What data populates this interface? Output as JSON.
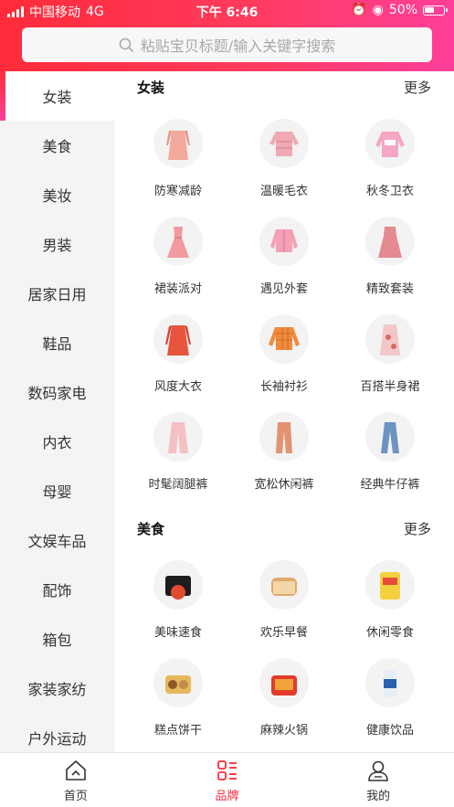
{
  "status_bar": {
    "carrier": "中国移动",
    "network": "4G",
    "time": "下午 6:46",
    "battery": "50%"
  },
  "search": {
    "placeholder": "粘贴宝贝标题/输入关键字搜索"
  },
  "colors": {
    "accent": "#ff2b3a",
    "accent_end": "#ff3f9a"
  },
  "sidebar": {
    "items": [
      {
        "label": "女装",
        "active": true
      },
      {
        "label": "美食"
      },
      {
        "label": "美妆"
      },
      {
        "label": "男装"
      },
      {
        "label": "居家日用"
      },
      {
        "label": "鞋品"
      },
      {
        "label": "数码家电"
      },
      {
        "label": "内衣"
      },
      {
        "label": "母婴"
      },
      {
        "label": "文娱车品"
      },
      {
        "label": "配饰"
      },
      {
        "label": "箱包"
      },
      {
        "label": "家装家纺"
      },
      {
        "label": "户外运动"
      }
    ]
  },
  "sections": [
    {
      "title": "女装",
      "more": "更多",
      "items": [
        {
          "label": "防寒减龄",
          "icon": "coat-icon"
        },
        {
          "label": "温暖毛衣",
          "icon": "sweater-icon"
        },
        {
          "label": "秋冬卫衣",
          "icon": "hoodie-icon"
        },
        {
          "label": "裙装派对",
          "icon": "dress-icon"
        },
        {
          "label": "遇见外套",
          "icon": "jacket-icon"
        },
        {
          "label": "精致套装",
          "icon": "long-dress-icon"
        },
        {
          "label": "风度大衣",
          "icon": "overcoat-icon"
        },
        {
          "label": "长袖衬衫",
          "icon": "shirt-icon"
        },
        {
          "label": "百搭半身裙",
          "icon": "skirt-icon"
        },
        {
          "label": "时髦阔腿裤",
          "icon": "wide-pants-icon"
        },
        {
          "label": "宽松休闲裤",
          "icon": "casual-pants-icon"
        },
        {
          "label": "经典牛仔裤",
          "icon": "jeans-icon"
        }
      ]
    },
    {
      "title": "美食",
      "more": "更多",
      "items": [
        {
          "label": "美味速食",
          "icon": "instant-food-icon"
        },
        {
          "label": "欢乐早餐",
          "icon": "bread-icon"
        },
        {
          "label": "休闲零食",
          "icon": "chips-icon"
        },
        {
          "label": "糕点饼干",
          "icon": "cookies-icon"
        },
        {
          "label": "麻辣火锅",
          "icon": "hotpot-icon"
        },
        {
          "label": "健康饮品",
          "icon": "drink-icon"
        }
      ]
    }
  ],
  "tabbar": {
    "tabs": [
      {
        "label": "首页",
        "icon": "home-icon"
      },
      {
        "label": "品牌",
        "icon": "brand-icon",
        "active": true
      },
      {
        "label": "我的",
        "icon": "profile-icon"
      }
    ]
  }
}
